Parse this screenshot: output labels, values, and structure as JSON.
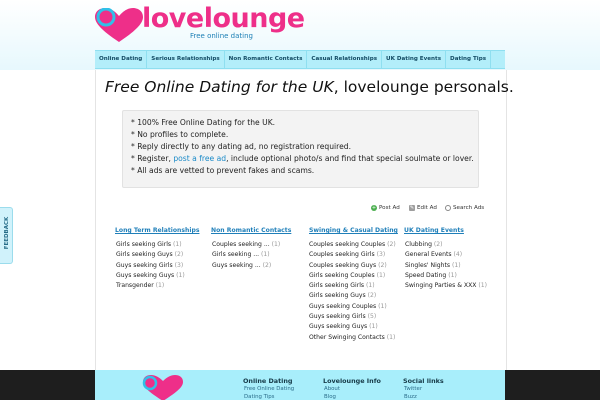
{
  "header": {
    "logo_text": "lovelounge",
    "tagline": "Free online dating"
  },
  "nav": [
    "Online Dating",
    "Serious Relationships",
    "Non Romantic Contacts",
    "Casual Relationships",
    "UK Dating Events",
    "Dating Tips"
  ],
  "headline": {
    "italic": "Free Online Dating for the UK",
    "rest": ", lovelounge personals."
  },
  "info": {
    "line1": "* 100% Free Online Dating for the UK.",
    "line2": "* No profiles to complete.",
    "line3": "* Reply directly to any dating ad, no registration required.",
    "line4_pre": "* Register, ",
    "line4_link": "post a free ad",
    "line4_post": ", include optional photo/s and find that special soulmate or lover.",
    "line5": "* All ads are vetted to prevent fakes and scams."
  },
  "actions": {
    "post": "Post Ad",
    "edit": "Edit Ad",
    "search": "Search Ads"
  },
  "columns": [
    {
      "title": "Long Term Relationships",
      "items": [
        {
          "label": "Girls seeking Girls",
          "count": "(1)"
        },
        {
          "label": "Girls seeking Guys",
          "count": "(2)"
        },
        {
          "label": "Guys seeking Girls",
          "count": "(3)"
        },
        {
          "label": "Guys seeking Guys",
          "count": "(1)"
        },
        {
          "label": "Transgender",
          "count": "(1)"
        }
      ]
    },
    {
      "title": "Non Romantic Contacts",
      "items": [
        {
          "label": "Couples seeking ...",
          "count": "(1)"
        },
        {
          "label": "Girls seeking ...",
          "count": "(1)"
        },
        {
          "label": "Guys seeking ...",
          "count": "(2)"
        }
      ]
    },
    {
      "title": "Swinging & Casual Dating",
      "items": [
        {
          "label": "Couples seeking Couples",
          "count": "(2)"
        },
        {
          "label": "Couples seeking Girls",
          "count": "(3)"
        },
        {
          "label": "Couples seeking Guys",
          "count": "(2)"
        },
        {
          "label": "Girls seeking Couples",
          "count": "(1)"
        },
        {
          "label": "Girls seeking Girls",
          "count": "(1)"
        },
        {
          "label": "Girls seeking Guys",
          "count": "(2)"
        },
        {
          "label": "Guys seeking Couples",
          "count": "(1)"
        },
        {
          "label": "Guys seeking Girls",
          "count": "(5)"
        },
        {
          "label": "Guys seeking Guys",
          "count": "(1)"
        },
        {
          "label": "Other Swinging Contacts",
          "count": "(1)"
        }
      ]
    },
    {
      "title": "UK Dating Events",
      "items": [
        {
          "label": "Clubbing",
          "count": "(2)"
        },
        {
          "label": "General Events",
          "count": "(4)"
        },
        {
          "label": "Singles' Nights",
          "count": "(1)"
        },
        {
          "label": "Speed Dating",
          "count": "(1)"
        },
        {
          "label": "Swinging Parties & XXX",
          "count": "(1)"
        }
      ]
    }
  ],
  "feedback_label": "FEEDBACK",
  "footer": {
    "col1": {
      "title": "Online Dating",
      "links": [
        "Free Online Dating",
        "Dating Tips"
      ]
    },
    "col2": {
      "title": "Lovelounge Info",
      "links": [
        "About",
        "Blog"
      ]
    },
    "col3": {
      "title": "Social links",
      "links": [
        "Twitter",
        "Buzz"
      ]
    }
  },
  "colors": {
    "brand_pink": "#ee2f89",
    "link_blue": "#1f7fb9",
    "nav_cyan": "#b3eefa"
  }
}
